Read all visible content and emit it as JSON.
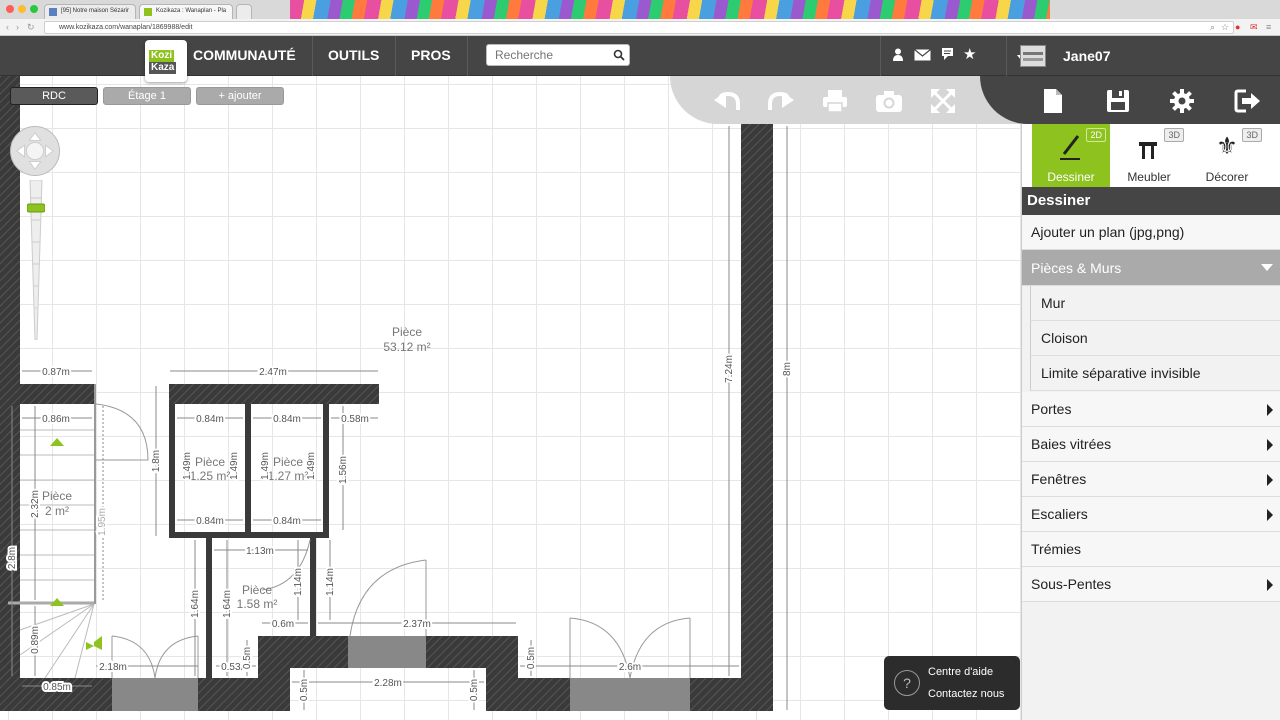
{
  "browser": {
    "tabs": [
      {
        "label": "[95] Notre maison Sézarir"
      },
      {
        "label": "Kozikaza : Wanaplan - Pla"
      }
    ],
    "url": "www.kozikaza.com/wanaplan/1869988/edit"
  },
  "header": {
    "logo_line1": "Kozi",
    "logo_line2": "Kaza",
    "nav": [
      "COMMUNAUTÉ",
      "OUTILS",
      "PROS"
    ],
    "search_placeholder": "Recherche",
    "username": "Jane07"
  },
  "floors": {
    "current": "RDC",
    "other": "Étage 1",
    "add": "+ ajouter"
  },
  "modes": [
    {
      "label": "Dessiner",
      "badge": "2D",
      "active": true
    },
    {
      "label": "Meubler",
      "badge": "3D",
      "active": false
    },
    {
      "label": "Décorer",
      "badge": "3D",
      "active": false
    }
  ],
  "panel": {
    "title": "Dessiner",
    "upload": "Ajouter un plan (jpg,png)",
    "section": "Pièces & Murs",
    "sub_items": [
      "Mur",
      "Cloison",
      "Limite séparative invisible"
    ],
    "items": [
      "Portes",
      "Baies vitrées",
      "Fenêtres",
      "Escaliers",
      "Trémies",
      "Sous-Pentes"
    ]
  },
  "help": {
    "help_center": "Centre d'aide",
    "contact": "Contactez nous"
  },
  "plan": {
    "rooms": [
      {
        "name": "Pièce",
        "area": "53.12 m²"
      },
      {
        "name": "Pièce",
        "area": "2 m²"
      },
      {
        "name": "Pièce",
        "area": "1.25 m²"
      },
      {
        "name": "Pièce",
        "area": "1.27 m²"
      },
      {
        "name": "Pièce",
        "area": "1.58 m²"
      }
    ],
    "dimensions": {
      "d087": "0.87m",
      "d247": "2.47m",
      "d724": "7.24m",
      "d8": "8m",
      "d086": "0.86m",
      "d084a": "0.84m",
      "d084b": "0.84m",
      "d058": "0.58m",
      "d18": "1.8m",
      "d149a": "1.49m",
      "d149b": "1.49m",
      "d149c": "1.49m",
      "d149d": "1.49m",
      "d156": "1.56m",
      "d084c": "0.84m",
      "d084d": "0.84m",
      "d232": "2.32m",
      "d195": "1.95m",
      "d113": "1.13m",
      "d28": "2.8m",
      "d164a": "1.64m",
      "d164b": "1.64m",
      "d114a": "1.14m",
      "d114b": "1.14m",
      "d06": "0.6m",
      "d237": "2.37m",
      "d089": "0.89m",
      "d218": "2.18m",
      "d053": "0.53m",
      "d05a": "0.5m",
      "d05b": "0.5m",
      "d26": "2.6m",
      "d085": "0.85m",
      "d228": "2.28m",
      "d05c": "0.5m",
      "d05d": "0.5m"
    }
  }
}
